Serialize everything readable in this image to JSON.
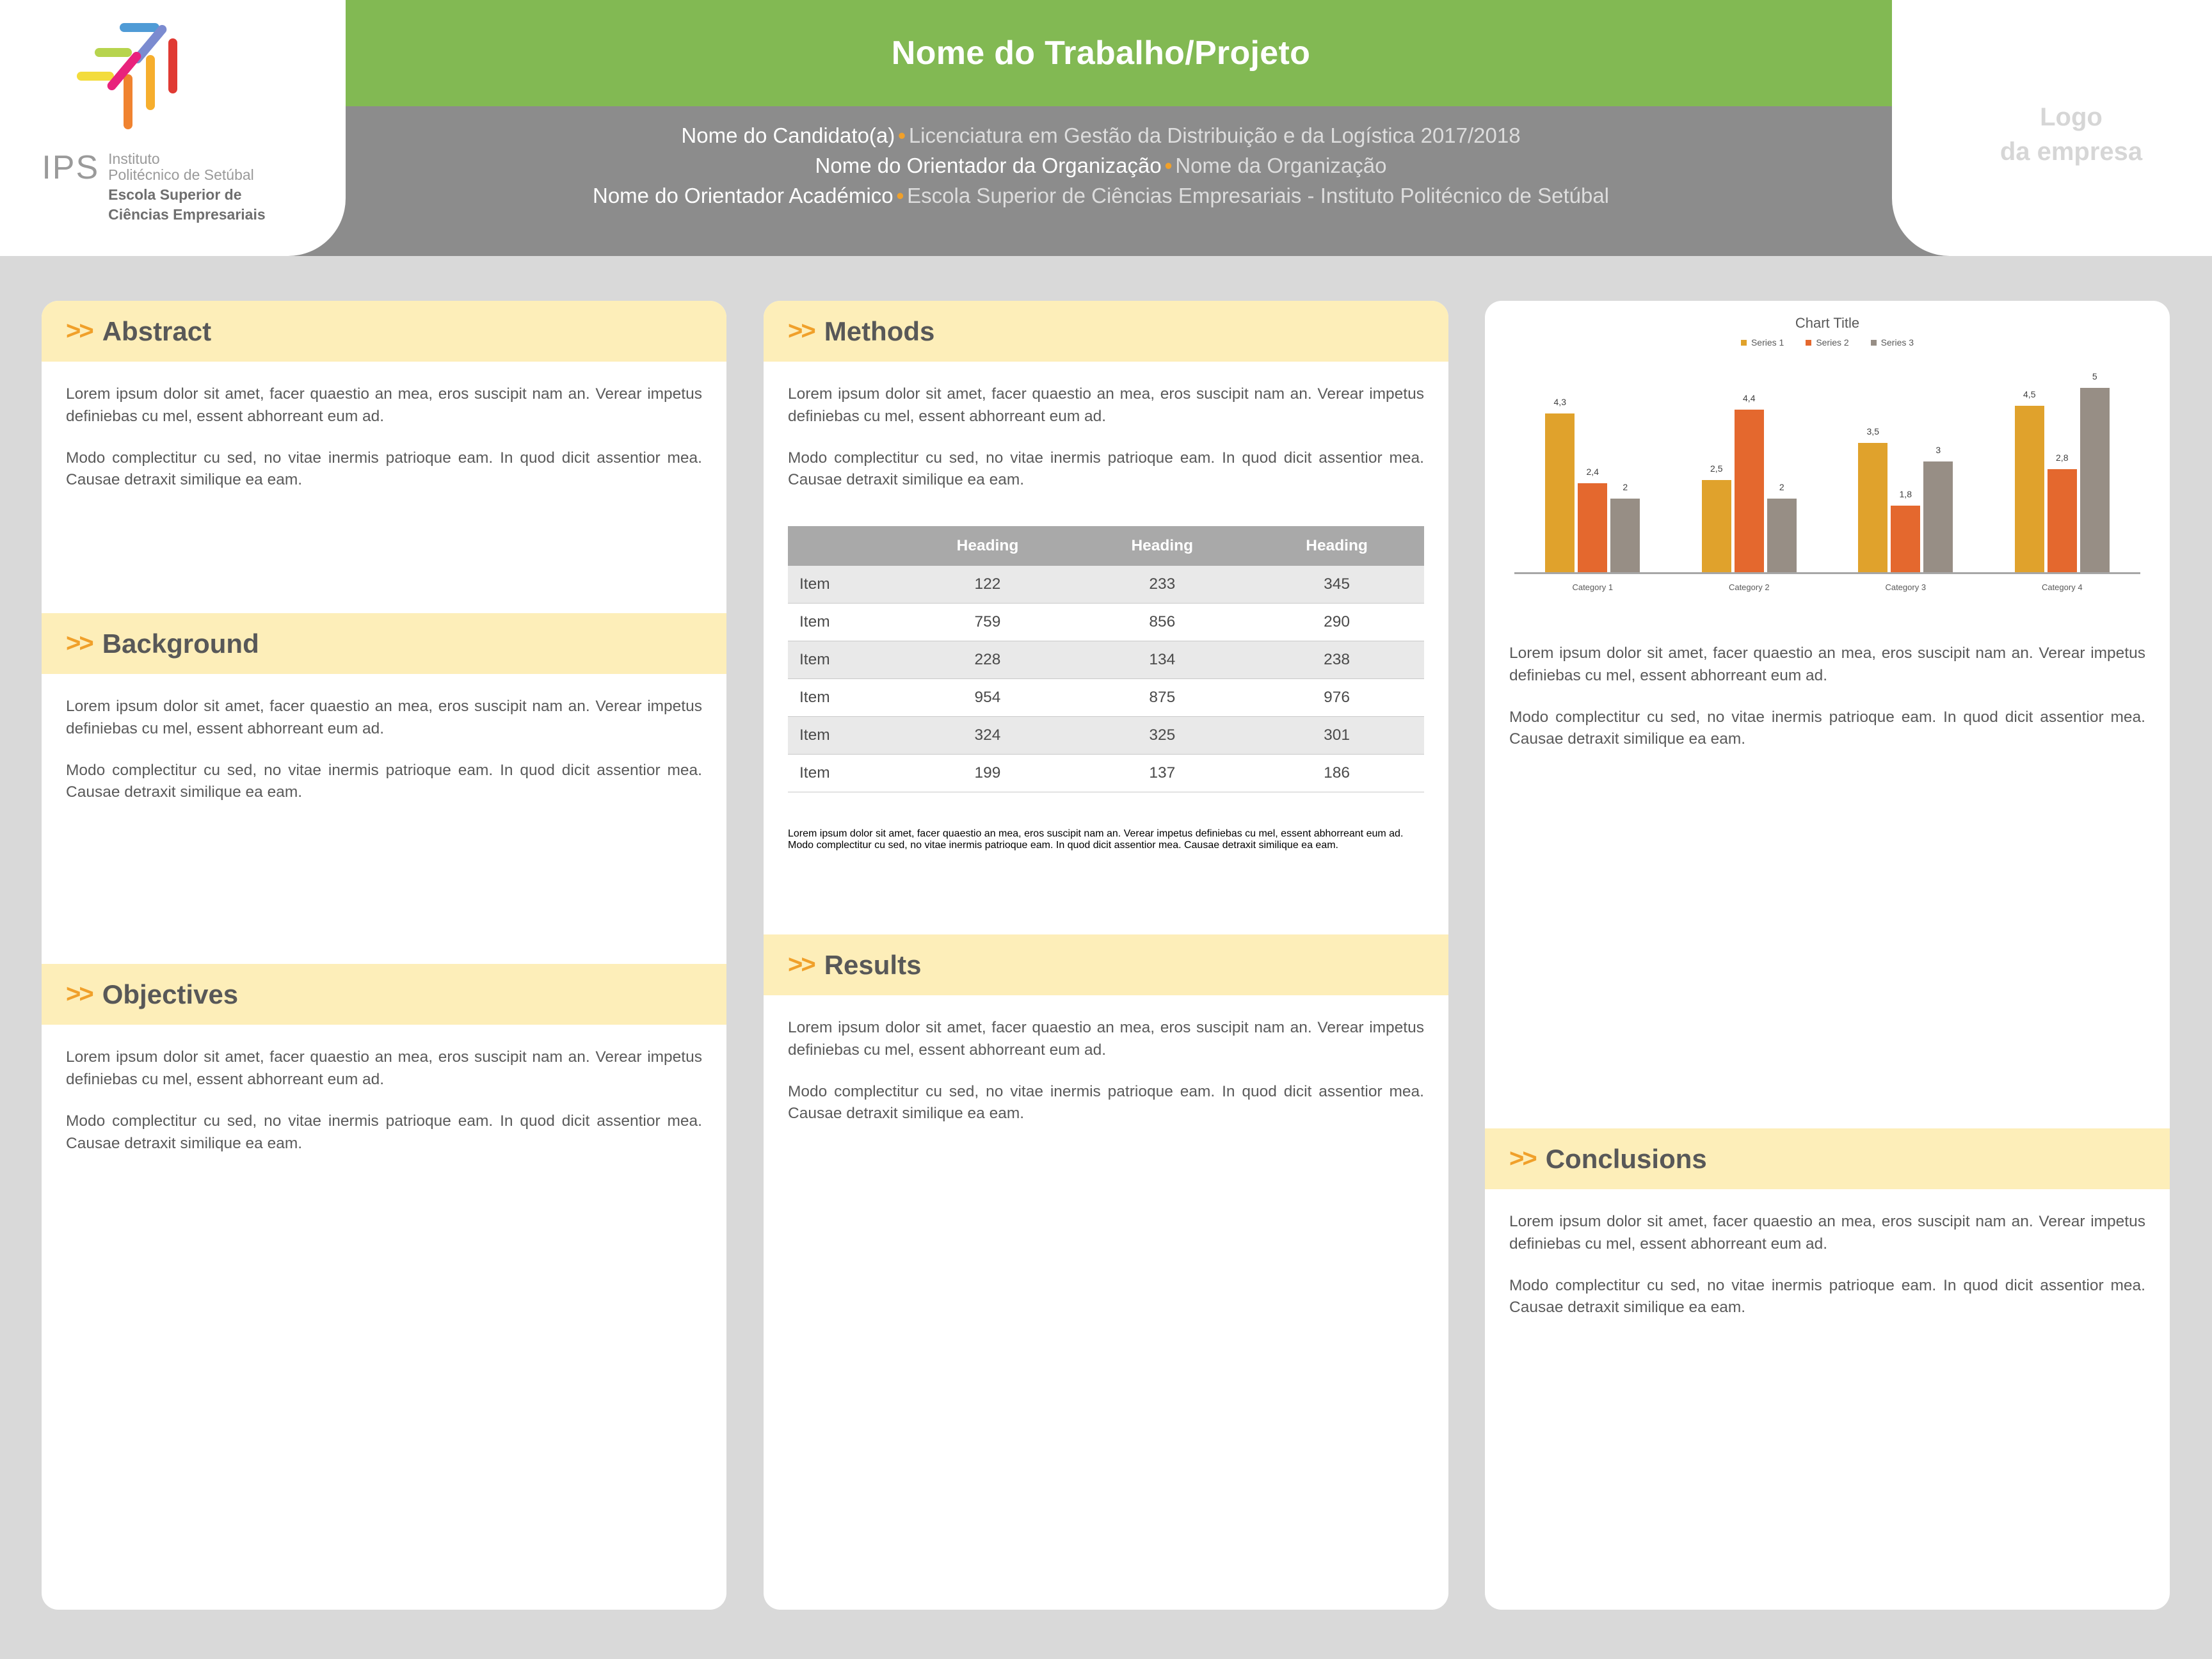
{
  "header": {
    "title": "Nome do Trabalho/Projeto",
    "author_line_1_strong": "Nome do Candidato(a)",
    "author_line_1_rest": "Licenciatura em Gestão da Distribuição e da Logística 2017/2018",
    "author_line_2_strong": "Nome do Orientador da Organização",
    "author_line_2_rest": "Nome da Organização",
    "author_line_3_strong": "Nome do Orientador Académico",
    "author_line_3_rest": "Escola Superior de Ciências Empresariais - Instituto Politécnico de Setúbal",
    "bullet": "•",
    "company_logo_line_1": "Logo",
    "company_logo_line_2": "da empresa",
    "green": "#82b953",
    "gray": "#8c8c8c",
    "accent": "#f0a02a"
  },
  "institution_logo": {
    "letters": "IPS",
    "name_line_1": "Instituto",
    "name_line_2": "Politécnico de Setúbal",
    "school_line_1": "Escola Superior de",
    "school_line_2": "Ciências Empresariais"
  },
  "chevron": ">>",
  "sections": {
    "abstract": {
      "title": "Abstract",
      "p1": "Lorem ipsum dolor sit amet, facer quaestio an mea, eros suscipit nam an. Verear impetus definiebas cu mel, essent abhorreant eum ad.",
      "p2": "Modo complectitur cu sed, no vitae inermis patrioque eam. In quod dicit assentior mea. Causae detraxit similique ea eam."
    },
    "background": {
      "title": "Background",
      "p1": "Lorem ipsum dolor sit amet, facer quaestio an mea, eros suscipit nam an. Verear impetus definiebas cu mel, essent abhorreant eum ad.",
      "p2": "Modo complectitur cu sed, no vitae inermis patrioque eam. In quod dicit assentior mea. Causae detraxit similique ea eam."
    },
    "objectives": {
      "title": "Objectives",
      "p1": "Lorem ipsum dolor sit amet, facer quaestio an mea, eros suscipit nam an. Verear impetus definiebas cu mel, essent abhorreant eum ad.",
      "p2": "Modo complectitur cu sed, no vitae inermis patrioque eam. In quod dicit assentior mea. Causae detraxit similique ea eam."
    },
    "methods": {
      "title": "Methods",
      "p1": "Lorem ipsum dolor sit amet, facer quaestio an mea, eros suscipit nam an. Verear impetus definiebas cu mel, essent abhorreant eum ad.",
      "p2": "Modo complectitur cu sed, no vitae inermis patrioque eam. In quod dicit assentior mea. Causae detraxit similique ea eam.",
      "p3": "Lorem ipsum dolor sit amet, facer quaestio an mea, eros suscipit nam an. Verear impetus definiebas cu mel, essent abhorreant eum ad.",
      "p4": "Modo complectitur cu sed, no vitae inermis patrioque eam. In quod dicit assentior mea. Causae detraxit similique ea eam."
    },
    "results": {
      "title": "Results",
      "p1": "Lorem ipsum dolor sit amet, facer quaestio an mea, eros suscipit nam an. Verear impetus definiebas cu mel, essent abhorreant eum ad.",
      "p2": "Modo complectitur cu sed, no vitae inermis patrioque eam. In quod dicit assentior mea. Causae detraxit similique ea eam."
    },
    "conclusions": {
      "title": "Conclusions",
      "p1": "Lorem ipsum dolor sit amet, facer quaestio an mea, eros suscipit nam an. Verear impetus definiebas cu mel, essent abhorreant eum ad.",
      "p2": "Modo complectitur cu sed, no vitae inermis patrioque eam. In quod dicit assentior mea. Causae detraxit similique ea eam."
    },
    "chart_panel": {
      "p1": "Lorem ipsum dolor sit amet, facer quaestio an mea, eros suscipit nam an. Verear impetus definiebas cu mel, essent abhorreant eum ad.",
      "p2": "Modo complectitur cu sed, no vitae inermis patrioque eam. In quod dicit assentior mea. Causae detraxit similique ea eam."
    }
  },
  "table": {
    "columns": [
      "",
      "Heading",
      "Heading",
      "Heading"
    ],
    "rows": [
      [
        "Item",
        "122",
        "233",
        "345"
      ],
      [
        "Item",
        "759",
        "856",
        "290"
      ],
      [
        "Item",
        "228",
        "134",
        "238"
      ],
      [
        "Item",
        "954",
        "875",
        "976"
      ],
      [
        "Item",
        "324",
        "325",
        "301"
      ],
      [
        "Item",
        "199",
        "137",
        "186"
      ]
    ]
  },
  "chart_data": {
    "type": "bar",
    "title": "Chart Title",
    "categories": [
      "Category 1",
      "Category 2",
      "Category 3",
      "Category 4"
    ],
    "series": [
      {
        "name": "Series 1",
        "color": "#e0a22c",
        "values": [
          4.3,
          2.5,
          3.5,
          4.5
        ],
        "labels": [
          "4,3",
          "2,5",
          "3,5",
          "4,5"
        ]
      },
      {
        "name": "Series 2",
        "color": "#e4682e",
        "values": [
          2.4,
          4.4,
          1.8,
          2.8
        ],
        "labels": [
          "2,4",
          "4,4",
          "1,8",
          "2,8"
        ]
      },
      {
        "name": "Series 3",
        "color": "#978e85",
        "values": [
          2,
          2,
          3,
          5
        ],
        "labels": [
          "2",
          "2",
          "3",
          "5"
        ]
      }
    ],
    "ylim": [
      0,
      5.6
    ],
    "grid": false,
    "legend_position": "top",
    "xlabel": "",
    "ylabel": ""
  }
}
